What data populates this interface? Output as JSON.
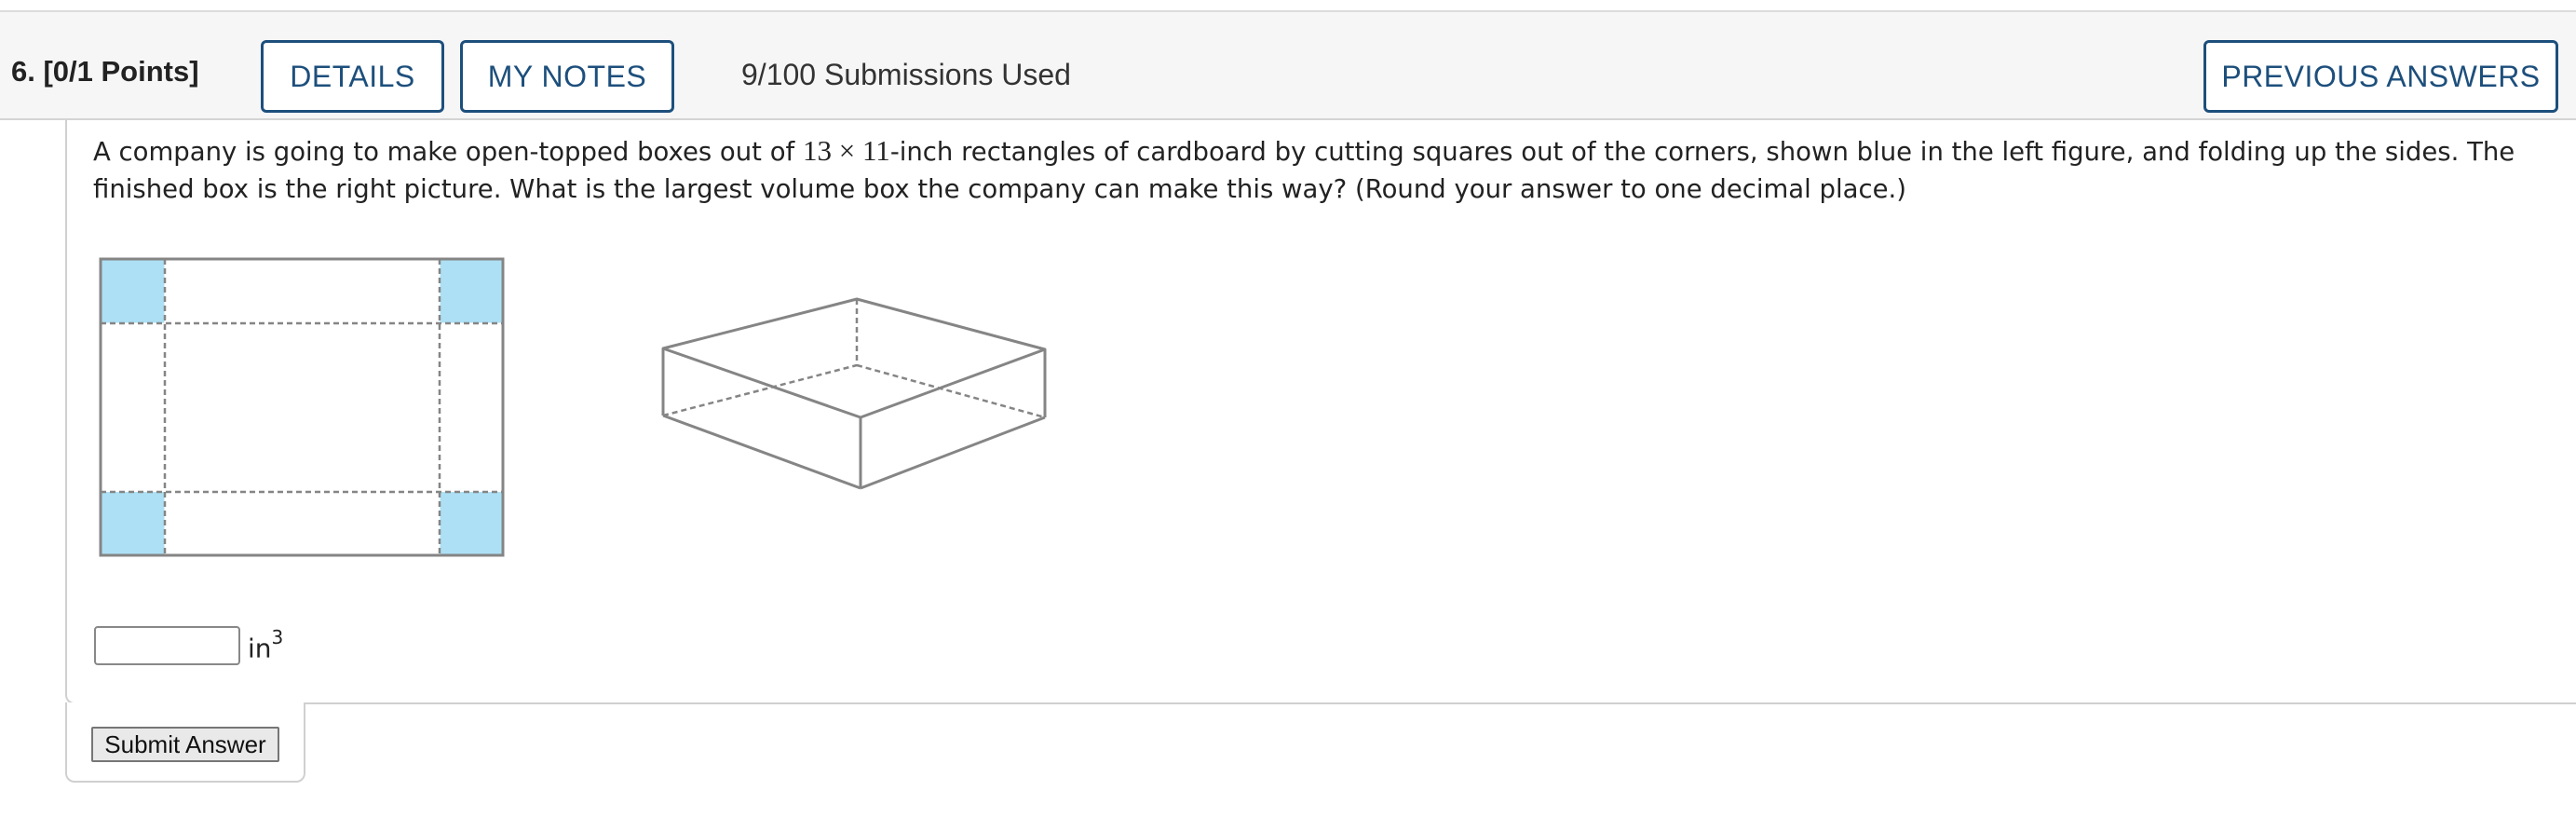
{
  "header": {
    "question_label": "6.  [0/1 Points]",
    "details_label": "DETAILS",
    "notes_label": "MY NOTES",
    "submissions_text": "9/100 Submissions Used",
    "previous_answers_label": "PREVIOUS ANSWERS"
  },
  "question": {
    "text_before": "A company is going to make open-topped boxes out of ",
    "dimensions": "13 × 11",
    "text_after": "-inch rectangles of cardboard by cutting squares out of the corners, shown blue in the left figure, and folding up the sides. The finished box is the right picture. What is the largest volume box the company can make this way? (Round your answer to one decimal place.)"
  },
  "figures": {
    "corner_color": "#ade0f5",
    "line_color": "#858585"
  },
  "answer": {
    "value": "",
    "unit_base": "in",
    "unit_exponent": "3"
  },
  "submit": {
    "label": "Submit Answer"
  }
}
